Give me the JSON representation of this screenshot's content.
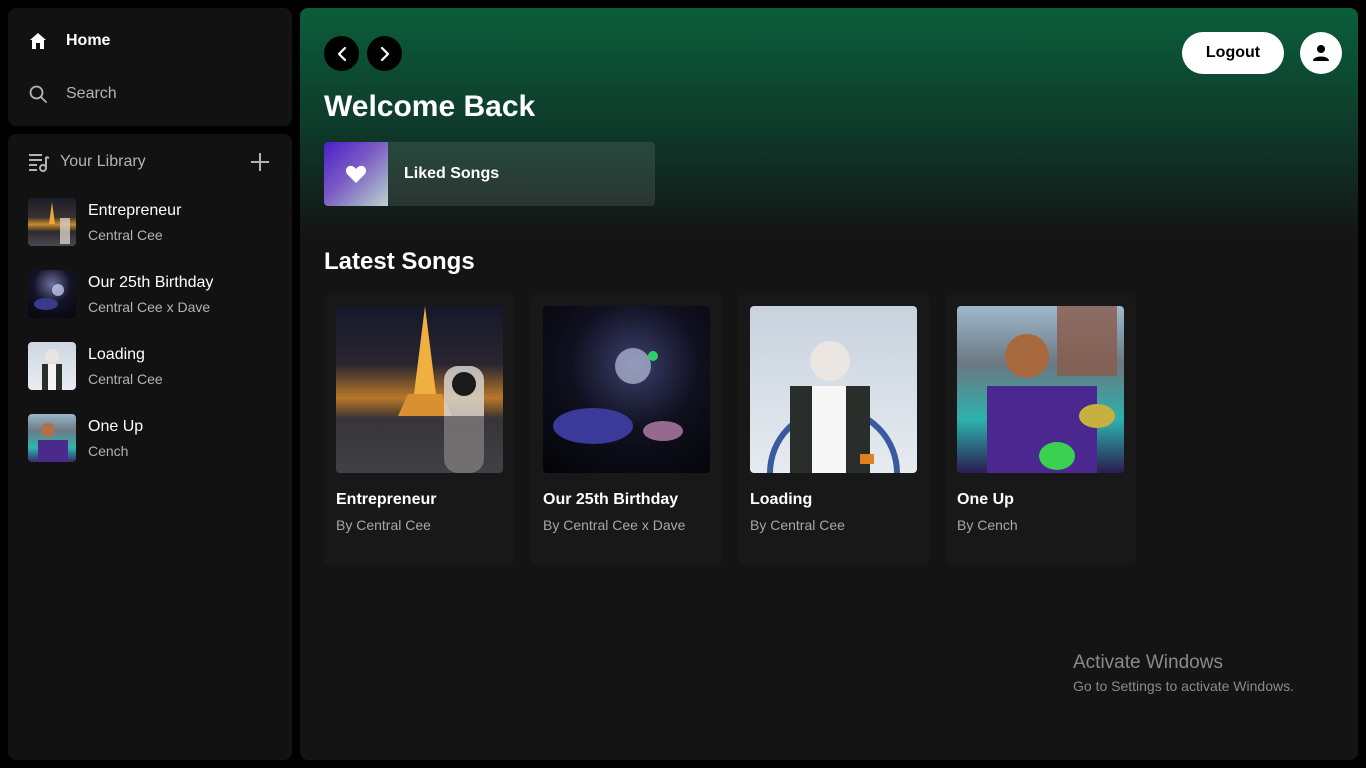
{
  "sidebar": {
    "nav": {
      "home_label": "Home",
      "search_label": "Search"
    },
    "library": {
      "title": "Your Library",
      "items": [
        {
          "title": "Entrepreneur",
          "artist": "Central Cee"
        },
        {
          "title": "Our 25th Birthday",
          "artist": "Central Cee x Dave"
        },
        {
          "title": "Loading",
          "artist": "Central Cee"
        },
        {
          "title": "One Up",
          "artist": "Cench"
        }
      ]
    }
  },
  "header": {
    "logout_label": "Logout"
  },
  "main": {
    "welcome": "Welcome Back",
    "liked_songs_label": "Liked Songs",
    "section_title": "Latest Songs",
    "songs": [
      {
        "title": "Entrepreneur",
        "artist": "By Central Cee"
      },
      {
        "title": "Our 25th Birthday",
        "artist": "By Central Cee x Dave"
      },
      {
        "title": "Loading",
        "artist": "By Central Cee"
      },
      {
        "title": "One Up",
        "artist": "By Cench"
      }
    ]
  },
  "watermark": {
    "line1": "Activate Windows",
    "line2": "Go to Settings to activate Windows."
  },
  "colors": {
    "accent_green": "#0b5e3b",
    "panel_bg": "#121212",
    "card_bg": "#181818"
  },
  "icons": [
    "home-icon",
    "search-icon",
    "library-icon",
    "plus-icon",
    "chevron-left-icon",
    "chevron-right-icon",
    "user-icon",
    "heart-icon"
  ]
}
